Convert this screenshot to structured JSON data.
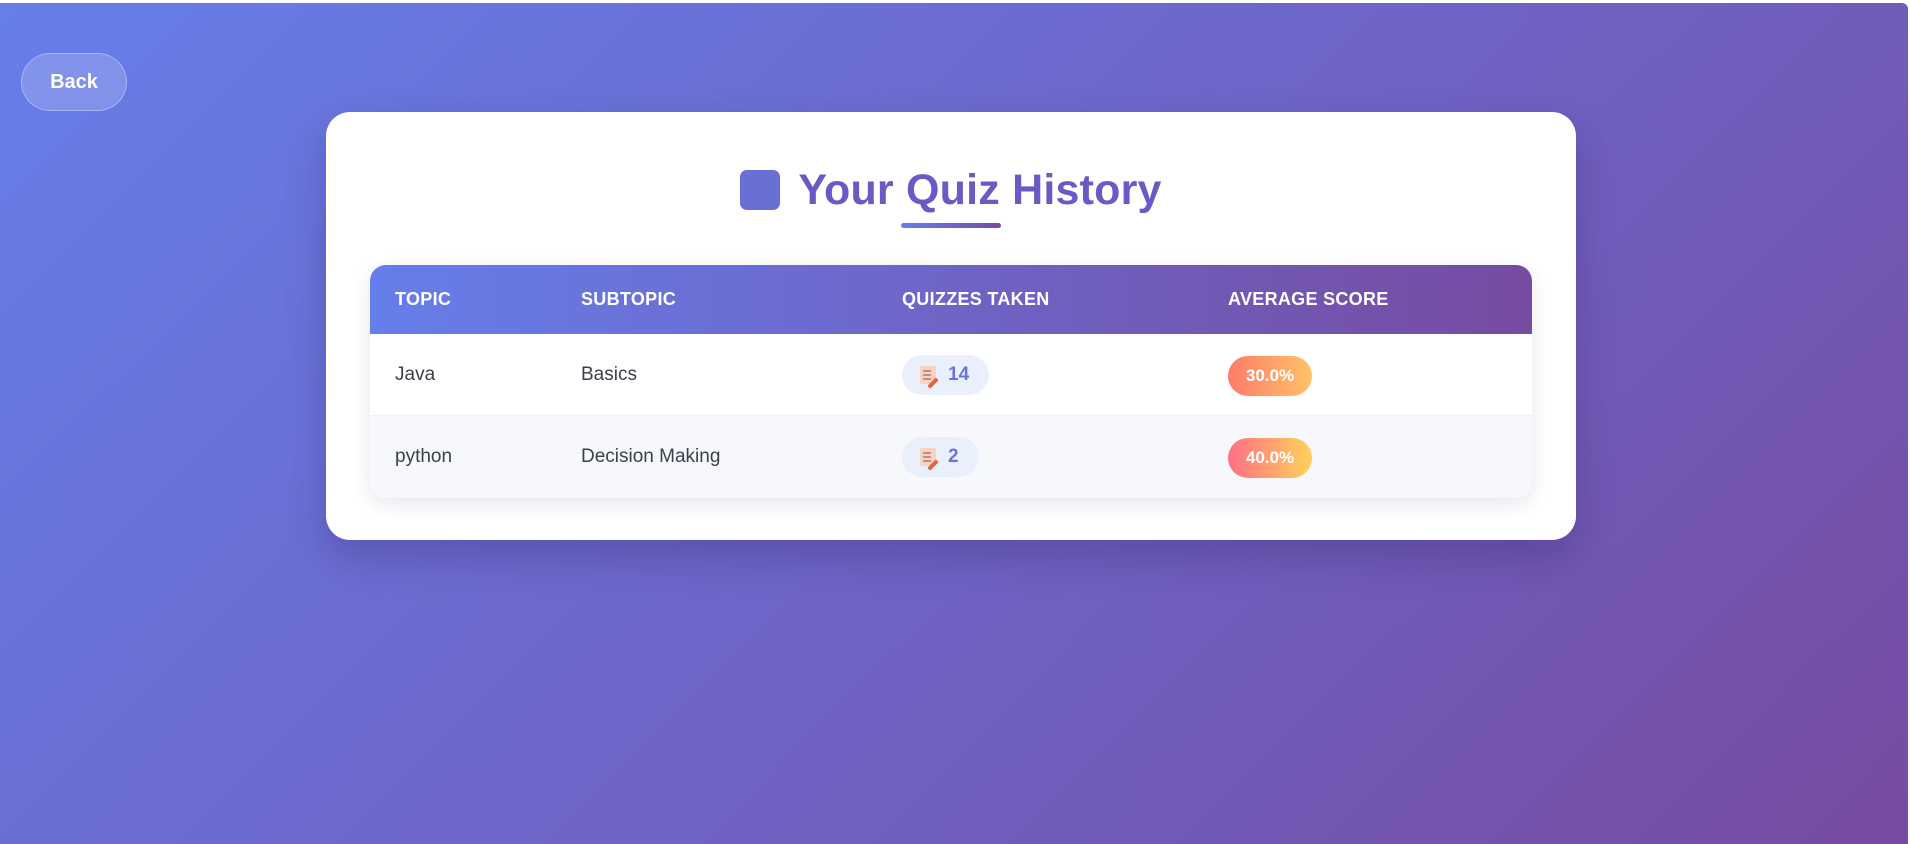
{
  "nav": {
    "back_label": "Back"
  },
  "page": {
    "title": "Your Quiz History"
  },
  "table": {
    "headers": [
      "TOPIC",
      "SUBTOPIC",
      "QUIZZES TAKEN",
      "AVERAGE SCORE"
    ],
    "rows": [
      {
        "topic": "Java",
        "subtopic": "Basics",
        "quizzes_taken": "14",
        "average_score": "30.0%"
      },
      {
        "topic": "python",
        "subtopic": "Decision Making",
        "quizzes_taken": "2",
        "average_score": "40.0%"
      }
    ]
  },
  "icons": {
    "title_icon": "square-icon",
    "quiz_count_icon": "memo-icon"
  },
  "colors": {
    "gradient_start": "#667eea",
    "gradient_end": "#764ba2",
    "title_color": "#6a5ac4",
    "score_row1": [
      "#ff7b6b",
      "#ffc166"
    ],
    "score_row2": [
      "#ff6f86",
      "#ffd25a"
    ]
  }
}
